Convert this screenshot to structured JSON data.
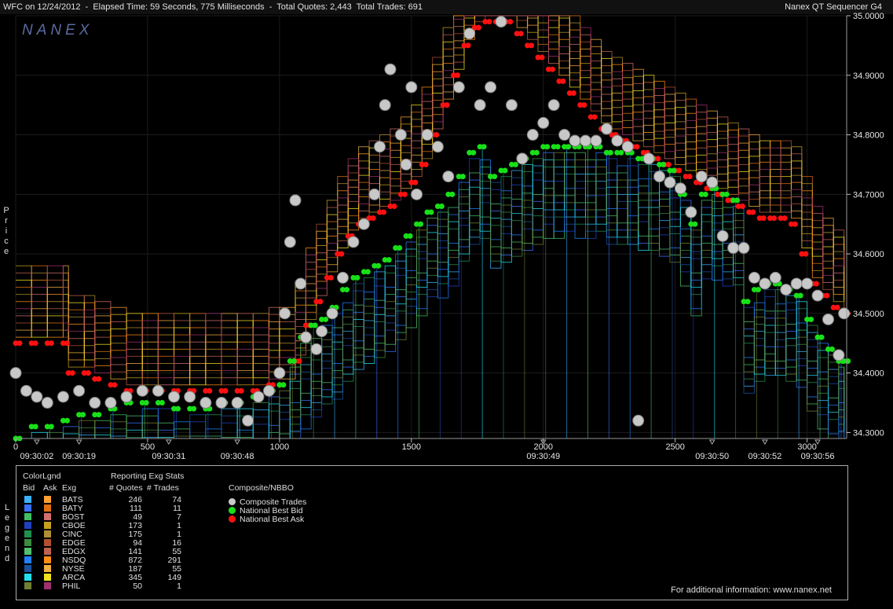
{
  "window": {
    "title_left": "WFC on 12/24/2012  -  Elapsed Time: 59 Seconds, 775 Milliseconds  -  Total Quotes: 2,443  Total Trades: 691",
    "title_right": "Nanex QT Sequencer G4"
  },
  "watermark": "NANEX",
  "price_label": "Price",
  "legend_label": "Legend",
  "chart_data": {
    "type": "line",
    "title": "WFC on 12/24/2012",
    "ylim": [
      34.29,
      35.0
    ],
    "xlim": [
      0,
      3150
    ],
    "y_ticks": [
      "34.3000",
      "34.4000",
      "34.5000",
      "34.6000",
      "34.7000",
      "34.8000",
      "34.9000",
      "35.0000"
    ],
    "x_ticks": [
      0,
      500,
      1000,
      1500,
      2000,
      2500,
      3000
    ],
    "time_labels": [
      {
        "x": 80,
        "label": "09:30:02"
      },
      {
        "x": 240,
        "label": "09:30:19"
      },
      {
        "x": 580,
        "label": "09:30:31"
      },
      {
        "x": 840,
        "label": "09:30:48"
      },
      {
        "x": 2000,
        "label": "09:30:49"
      },
      {
        "x": 2640,
        "label": "09:30:50"
      },
      {
        "x": 2840,
        "label": "09:30:52"
      },
      {
        "x": 3040,
        "label": "09:30:56"
      }
    ],
    "series": [
      {
        "name": "National Best Ask",
        "color": "#ff1010",
        "points": [
          [
            0,
            34.45
          ],
          [
            60,
            34.45
          ],
          [
            120,
            34.45
          ],
          [
            180,
            34.45
          ],
          [
            200,
            34.4
          ],
          [
            260,
            34.4
          ],
          [
            300,
            34.39
          ],
          [
            360,
            34.38
          ],
          [
            420,
            34.37
          ],
          [
            480,
            34.37
          ],
          [
            540,
            34.37
          ],
          [
            600,
            34.37
          ],
          [
            660,
            34.37
          ],
          [
            720,
            34.37
          ],
          [
            780,
            34.37
          ],
          [
            840,
            34.37
          ],
          [
            900,
            34.37
          ],
          [
            960,
            34.38
          ],
          [
            1000,
            34.38
          ],
          [
            1060,
            34.42
          ],
          [
            1100,
            34.48
          ],
          [
            1140,
            34.52
          ],
          [
            1180,
            34.56
          ],
          [
            1220,
            34.6
          ],
          [
            1260,
            34.63
          ],
          [
            1300,
            34.65
          ],
          [
            1340,
            34.66
          ],
          [
            1380,
            34.67
          ],
          [
            1420,
            34.68
          ],
          [
            1460,
            34.7
          ],
          [
            1500,
            34.72
          ],
          [
            1540,
            34.75
          ],
          [
            1580,
            34.8
          ],
          [
            1620,
            34.85
          ],
          [
            1660,
            34.9
          ],
          [
            1700,
            34.95
          ],
          [
            1740,
            34.98
          ],
          [
            1780,
            34.99
          ],
          [
            1820,
            34.99
          ],
          [
            1860,
            34.99
          ],
          [
            1900,
            34.97
          ],
          [
            1940,
            34.95
          ],
          [
            1980,
            34.93
          ],
          [
            2020,
            34.91
          ],
          [
            2060,
            34.89
          ],
          [
            2100,
            34.87
          ],
          [
            2140,
            34.85
          ],
          [
            2180,
            34.83
          ],
          [
            2220,
            34.81
          ],
          [
            2260,
            34.8
          ],
          [
            2300,
            34.79
          ],
          [
            2340,
            34.78
          ],
          [
            2380,
            34.77
          ],
          [
            2420,
            34.76
          ],
          [
            2460,
            34.75
          ],
          [
            2500,
            34.74
          ],
          [
            2540,
            34.73
          ],
          [
            2580,
            34.72
          ],
          [
            2620,
            34.71
          ],
          [
            2660,
            34.7
          ],
          [
            2700,
            34.69
          ],
          [
            2740,
            34.68
          ],
          [
            2780,
            34.67
          ],
          [
            2820,
            34.66
          ],
          [
            2860,
            34.66
          ],
          [
            2900,
            34.66
          ],
          [
            2940,
            34.65
          ],
          [
            2980,
            34.6
          ],
          [
            3020,
            34.55
          ],
          [
            3060,
            34.53
          ],
          [
            3100,
            34.51
          ],
          [
            3140,
            34.5
          ]
        ]
      },
      {
        "name": "National Best Bid",
        "color": "#18e018",
        "points": [
          [
            0,
            34.29
          ],
          [
            60,
            34.31
          ],
          [
            120,
            34.31
          ],
          [
            180,
            34.32
          ],
          [
            240,
            34.33
          ],
          [
            300,
            34.33
          ],
          [
            360,
            34.34
          ],
          [
            420,
            34.35
          ],
          [
            480,
            34.35
          ],
          [
            540,
            34.35
          ],
          [
            600,
            34.34
          ],
          [
            660,
            34.34
          ],
          [
            720,
            34.34
          ],
          [
            780,
            34.35
          ],
          [
            840,
            34.35
          ],
          [
            900,
            34.36
          ],
          [
            960,
            34.37
          ],
          [
            1000,
            34.38
          ],
          [
            1040,
            34.42
          ],
          [
            1080,
            34.46
          ],
          [
            1120,
            34.48
          ],
          [
            1160,
            34.49
          ],
          [
            1200,
            34.51
          ],
          [
            1240,
            34.54
          ],
          [
            1280,
            34.56
          ],
          [
            1320,
            34.57
          ],
          [
            1360,
            34.58
          ],
          [
            1400,
            34.59
          ],
          [
            1440,
            34.61
          ],
          [
            1480,
            34.63
          ],
          [
            1520,
            34.65
          ],
          [
            1560,
            34.67
          ],
          [
            1600,
            34.68
          ],
          [
            1640,
            34.7
          ],
          [
            1680,
            34.73
          ],
          [
            1720,
            34.77
          ],
          [
            1760,
            34.78
          ],
          [
            1800,
            34.73
          ],
          [
            1840,
            34.74
          ],
          [
            1880,
            34.75
          ],
          [
            1920,
            34.76
          ],
          [
            1960,
            34.77
          ],
          [
            2000,
            34.78
          ],
          [
            2040,
            34.78
          ],
          [
            2080,
            34.78
          ],
          [
            2120,
            34.78
          ],
          [
            2160,
            34.78
          ],
          [
            2200,
            34.78
          ],
          [
            2240,
            34.77
          ],
          [
            2280,
            34.77
          ],
          [
            2320,
            34.77
          ],
          [
            2360,
            34.76
          ],
          [
            2400,
            34.76
          ],
          [
            2440,
            34.75
          ],
          [
            2480,
            34.74
          ],
          [
            2520,
            34.7
          ],
          [
            2560,
            34.65
          ],
          [
            2600,
            34.7
          ],
          [
            2640,
            34.71
          ],
          [
            2680,
            34.7
          ],
          [
            2720,
            34.69
          ],
          [
            2760,
            34.52
          ],
          [
            2800,
            34.54
          ],
          [
            2840,
            34.55
          ],
          [
            2880,
            34.55
          ],
          [
            2920,
            34.54
          ],
          [
            2960,
            34.53
          ],
          [
            3000,
            34.49
          ],
          [
            3040,
            34.46
          ],
          [
            3080,
            34.44
          ],
          [
            3120,
            34.42
          ],
          [
            3140,
            34.42
          ]
        ]
      },
      {
        "name": "Composite Trades",
        "color": "#c8c8c8",
        "points": [
          [
            0,
            34.4
          ],
          [
            40,
            34.37
          ],
          [
            80,
            34.36
          ],
          [
            120,
            34.35
          ],
          [
            180,
            34.36
          ],
          [
            240,
            34.37
          ],
          [
            300,
            34.35
          ],
          [
            360,
            34.35
          ],
          [
            420,
            34.36
          ],
          [
            480,
            34.37
          ],
          [
            540,
            34.37
          ],
          [
            600,
            34.36
          ],
          [
            660,
            34.36
          ],
          [
            720,
            34.35
          ],
          [
            780,
            34.35
          ],
          [
            840,
            34.35
          ],
          [
            880,
            34.32
          ],
          [
            920,
            34.36
          ],
          [
            960,
            34.37
          ],
          [
            1000,
            34.4
          ],
          [
            1020,
            34.5
          ],
          [
            1040,
            34.62
          ],
          [
            1060,
            34.69
          ],
          [
            1080,
            34.55
          ],
          [
            1100,
            34.46
          ],
          [
            1140,
            34.44
          ],
          [
            1160,
            34.47
          ],
          [
            1200,
            34.5
          ],
          [
            1240,
            34.56
          ],
          [
            1280,
            34.62
          ],
          [
            1320,
            34.65
          ],
          [
            1360,
            34.7
          ],
          [
            1380,
            34.78
          ],
          [
            1400,
            34.85
          ],
          [
            1420,
            34.91
          ],
          [
            1460,
            34.8
          ],
          [
            1480,
            34.75
          ],
          [
            1500,
            34.88
          ],
          [
            1520,
            34.7
          ],
          [
            1560,
            34.8
          ],
          [
            1600,
            34.78
          ],
          [
            1640,
            34.73
          ],
          [
            1680,
            34.88
          ],
          [
            1720,
            34.97
          ],
          [
            1760,
            34.85
          ],
          [
            1800,
            34.88
          ],
          [
            1840,
            34.99
          ],
          [
            1880,
            34.85
          ],
          [
            1920,
            34.76
          ],
          [
            1960,
            34.8
          ],
          [
            2000,
            34.82
          ],
          [
            2040,
            34.85
          ],
          [
            2080,
            34.8
          ],
          [
            2120,
            34.79
          ],
          [
            2160,
            34.79
          ],
          [
            2200,
            34.79
          ],
          [
            2240,
            34.81
          ],
          [
            2280,
            34.79
          ],
          [
            2320,
            34.78
          ],
          [
            2360,
            34.32
          ],
          [
            2400,
            34.76
          ],
          [
            2440,
            34.73
          ],
          [
            2480,
            34.72
          ],
          [
            2520,
            34.71
          ],
          [
            2560,
            34.67
          ],
          [
            2600,
            34.73
          ],
          [
            2640,
            34.72
          ],
          [
            2680,
            34.63
          ],
          [
            2720,
            34.61
          ],
          [
            2760,
            34.61
          ],
          [
            2800,
            34.56
          ],
          [
            2840,
            34.55
          ],
          [
            2880,
            34.56
          ],
          [
            2920,
            34.54
          ],
          [
            2960,
            34.55
          ],
          [
            3000,
            34.55
          ],
          [
            3040,
            34.53
          ],
          [
            3080,
            34.49
          ],
          [
            3120,
            34.43
          ],
          [
            3140,
            34.5
          ]
        ]
      }
    ],
    "legend_position": "bottom"
  },
  "legend": {
    "color_legend": "ColorLgnd",
    "bid_hdr": "Bid",
    "ask_hdr": "Ask",
    "exg_hdr": "Exg",
    "stats_hdr": "Reporting Exg Stats",
    "quotes_hdr": "# Quotes",
    "trades_hdr": "# Trades",
    "composite_hdr": "Composite/NBBO",
    "rows": [
      {
        "exg": "BATS",
        "quotes": "246",
        "trades": "74",
        "bid": "#3ab0ff",
        "ask": "#ffa030"
      },
      {
        "exg": "BATY",
        "quotes": "111",
        "trades": "11",
        "bid": "#3a70ff",
        "ask": "#e07010"
      },
      {
        "exg": "BOST",
        "quotes": "49",
        "trades": "7",
        "bid": "#40c060",
        "ask": "#d07070"
      },
      {
        "exg": "CBOE",
        "quotes": "173",
        "trades": "1",
        "bid": "#2040c0",
        "ask": "#c8a020"
      },
      {
        "exg": "CINC",
        "quotes": "175",
        "trades": "1",
        "bid": "#209050",
        "ask": "#b09030"
      },
      {
        "exg": "EDGE",
        "quotes": "94",
        "trades": "16",
        "bid": "#3c8c40",
        "ask": "#b05030"
      },
      {
        "exg": "EDGX",
        "quotes": "141",
        "trades": "55",
        "bid": "#50c070",
        "ask": "#c06050"
      },
      {
        "exg": "NSDQ",
        "quotes": "872",
        "trades": "291",
        "bid": "#2080ff",
        "ask": "#ff8c10"
      },
      {
        "exg": "NYSE",
        "quotes": "187",
        "trades": "55",
        "bid": "#1a50a0",
        "ask": "#f0b040"
      },
      {
        "exg": "ARCA",
        "quotes": "345",
        "trades": "149",
        "bid": "#20e0f0",
        "ask": "#f0e020"
      },
      {
        "exg": "PHIL",
        "quotes": "50",
        "trades": "1",
        "bid": "#708030",
        "ask": "#a03070"
      }
    ],
    "composite": [
      {
        "label": "Composite Trades",
        "color": "#c8c8c8"
      },
      {
        "label": "National Best Bid",
        "color": "#18e018"
      },
      {
        "label": "National Best Ask",
        "color": "#ff1010"
      }
    ],
    "footer": "For additional information: www.nanex.net"
  }
}
